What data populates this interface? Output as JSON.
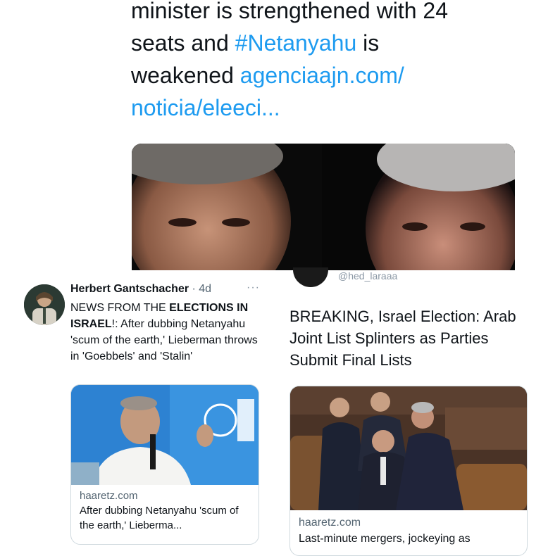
{
  "top_tweet": {
    "line1": "minister is strengthened with 24",
    "line2_pre": "seats and ",
    "hashtag": "#Netanyahu",
    "line2_post": " is",
    "line3_pre": "weakened ",
    "link_part1": "agenciaajn.com/",
    "link_part2": "noticia/eleeci..."
  },
  "left_tweet": {
    "author": "Herbert Gantschacher",
    "separator": " · ",
    "age": "4d",
    "more": "···",
    "body_pre": "NEWS FROM THE ",
    "body_bold": "ELECTIONS IN ISRAEL",
    "body_post": "!: After dubbing Netanyahu 'scum of the earth,' Lieberman throws in 'Goebbels' and 'Stalin'",
    "card": {
      "domain": "haaretz.com",
      "title": "After dubbing Netanyahu 'scum of the earth,' Lieberma..."
    }
  },
  "right_tweet": {
    "handle_fragment": "@hed_laraaa",
    "headline": "BREAKING, Israel Election: Arab Joint List Splinters as Parties Submit Final Lists",
    "card": {
      "domain": "haaretz.com",
      "title_fragment": "Last-minute mergers, jockeying as"
    }
  },
  "colors": {
    "link": "#1d9bf0",
    "text": "#0f1419",
    "secondary": "#536471",
    "border": "#cfd9de"
  }
}
